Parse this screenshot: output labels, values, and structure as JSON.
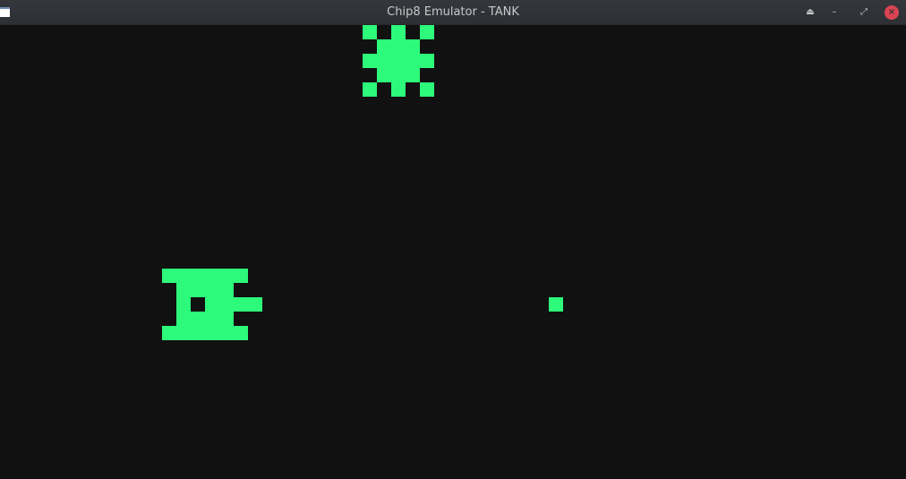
{
  "window": {
    "title": "Chip8 Emulator - TANK",
    "app_icon": "window-icon",
    "controls": {
      "keep_above_icon": "⏏",
      "minimize_icon": "–",
      "maximize_icon": "⤢",
      "close_icon": "×"
    }
  },
  "display": {
    "background_color": "#111111",
    "pixel_color": "#2dfa7a"
  }
}
